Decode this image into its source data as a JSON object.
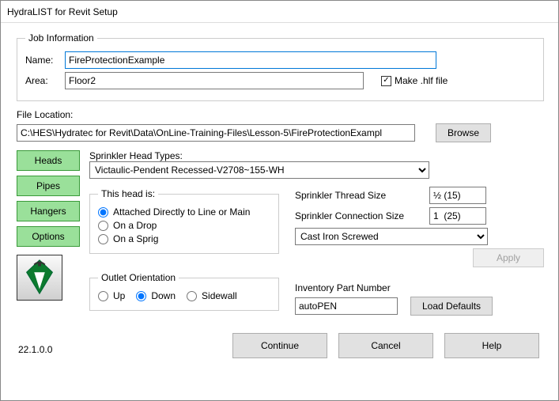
{
  "window": {
    "title": "HydraLIST for Revit Setup"
  },
  "job": {
    "legend": "Job Information",
    "name_label": "Name:",
    "name_value": "FireProtectionExample",
    "area_label": "Area:",
    "area_value": "Floor2",
    "make_hlf_label": "Make .hlf file",
    "make_hlf_checked": true
  },
  "file": {
    "label": "File Location:",
    "path": "C:\\HES\\Hydratec for Revit\\Data\\OnLine-Training-Files\\Lesson-5\\FireProtectionExampl",
    "browse": "Browse"
  },
  "side": {
    "heads": "Heads",
    "pipes": "Pipes",
    "hangers": "Hangers",
    "options": "Options"
  },
  "heads": {
    "types_label": "Sprinkler Head Types:",
    "selected_type": "Victaulic-Pendent Recessed-V2708~155-WH",
    "this_head_legend": "This head is:",
    "opt_attached": "Attached Directly to Line or Main",
    "opt_drop": "On a Drop",
    "opt_sprig": "On a Sprig",
    "thread_label": "Sprinkler Thread Size",
    "thread_value": "½ (15)",
    "conn_label": "Sprinkler Connection Size",
    "conn_value": "1  (25)",
    "fitting_value": "Cast Iron Screwed",
    "apply": "Apply",
    "outlet_legend": "Outlet Orientation",
    "opt_up": "Up",
    "opt_down": "Down",
    "opt_sidewall": "Sidewall",
    "inv_label": "Inventory Part Number",
    "inv_value": "autoPEN",
    "load_defaults": "Load Defaults"
  },
  "bottom": {
    "continue": "Continue",
    "cancel": "Cancel",
    "help": "Help"
  },
  "version": "22.1.0.0"
}
